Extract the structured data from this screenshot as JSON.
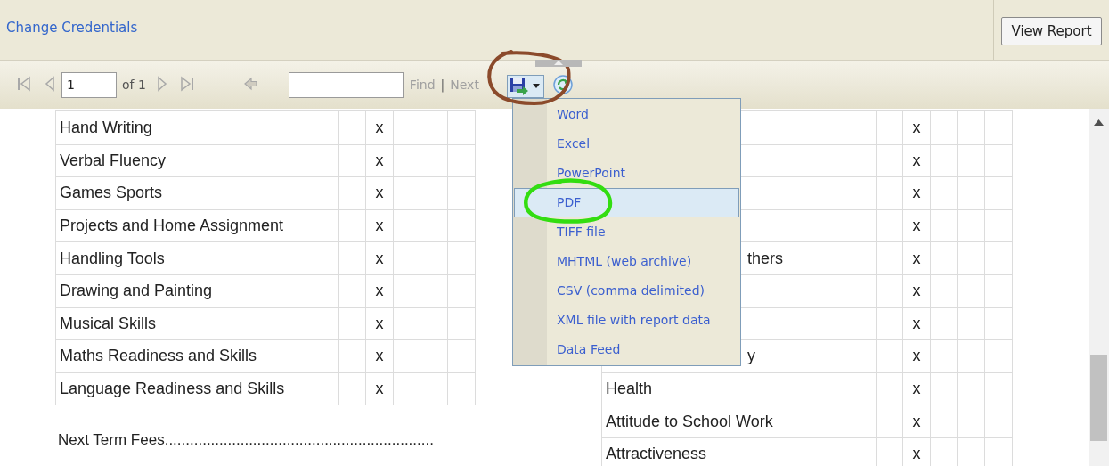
{
  "header": {
    "link": "Change Credentials",
    "button": "View Report"
  },
  "toolbar": {
    "page": "1",
    "page_count": "of 1",
    "find": "Find",
    "separator": "|",
    "next": "Next"
  },
  "export_menu": {
    "items": [
      {
        "label": "Word",
        "selected": false
      },
      {
        "label": "Excel",
        "selected": false
      },
      {
        "label": "PowerPoint",
        "selected": false
      },
      {
        "label": "PDF",
        "selected": true
      },
      {
        "label": "TIFF file",
        "selected": false
      },
      {
        "label": "MHTML (web archive)",
        "selected": false
      },
      {
        "label": "CSV (comma delimited)",
        "selected": false
      },
      {
        "label": "XML file with report data",
        "selected": false
      },
      {
        "label": "Data Feed",
        "selected": false
      }
    ]
  },
  "left_table": {
    "rows": [
      {
        "label": "Hand Writing",
        "rating": "x"
      },
      {
        "label": "Verbal Fluency",
        "rating": "x"
      },
      {
        "label": "Games Sports",
        "rating": "x"
      },
      {
        "label": "Projects and Home Assignment",
        "rating": "x"
      },
      {
        "label": "Handling Tools",
        "rating": "x"
      },
      {
        "label": "Drawing and Painting",
        "rating": "x"
      },
      {
        "label": "Musical Skills",
        "rating": "x"
      },
      {
        "label": "Maths Readiness and Skills",
        "rating": "x"
      },
      {
        "label": "Language Readiness and Skills",
        "rating": "x"
      }
    ]
  },
  "footer_text": "Next Term Fees................................................................",
  "right_table": {
    "rows": [
      {
        "rating": "x"
      },
      {
        "rating": "x"
      },
      {
        "rating": "x"
      },
      {
        "rating": "x"
      },
      {
        "label_tail": "thers",
        "rating": "x"
      },
      {
        "rating": "x"
      },
      {
        "rating": "x"
      },
      {
        "label_tail": "y",
        "rating": "x"
      },
      {
        "label": "Health",
        "rating": "x"
      },
      {
        "label": "Attitude to School Work",
        "rating": "x"
      },
      {
        "label": "Attractiveness",
        "rating": "x"
      }
    ]
  }
}
